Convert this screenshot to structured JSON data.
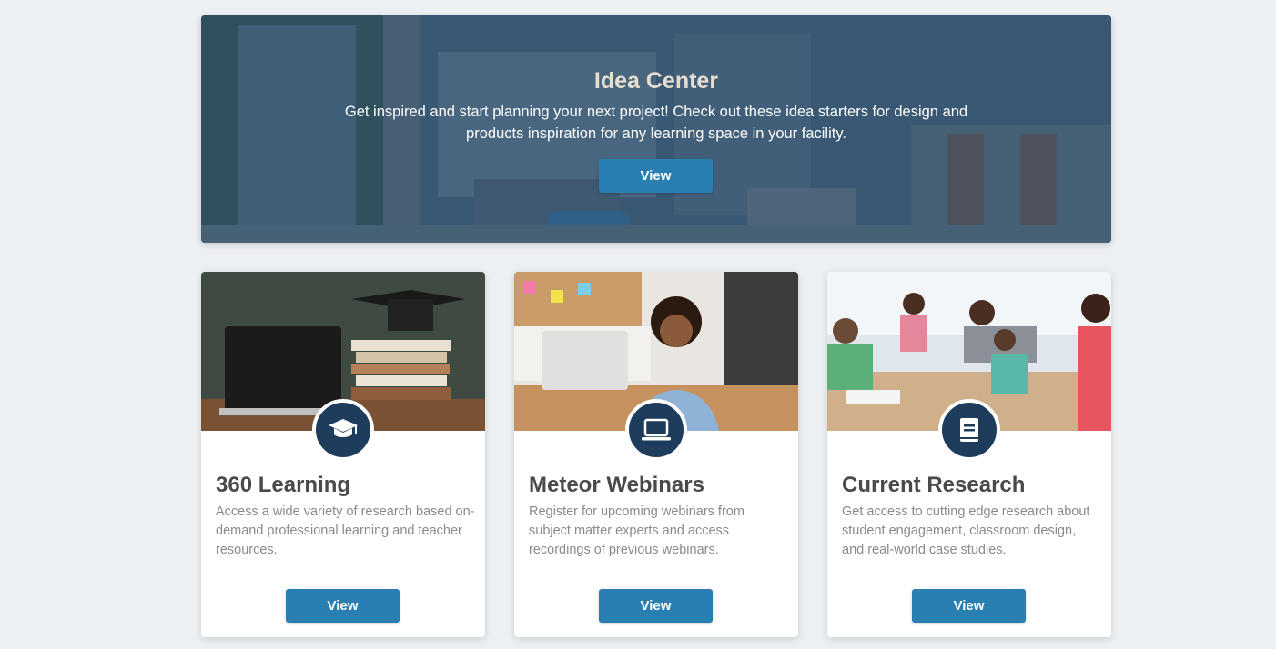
{
  "hero": {
    "title": "Idea Center",
    "description": "Get inspired and start planning your next project! Check out these idea starters for design and products inspiration for any learning space in your facility.",
    "button_label": "View"
  },
  "cards": [
    {
      "title": "360 Learning",
      "description": "Access a wide variety of research based on-demand professional learning and teacher resources.",
      "button_label": "View",
      "icon": "graduation-cap-icon"
    },
    {
      "title": "Meteor Webinars",
      "description": "Register for upcoming webinars from subject matter experts and access recordings of previous webinars.",
      "button_label": "View",
      "icon": "laptop-icon"
    },
    {
      "title": "Current Research",
      "description": "Get access to cutting edge research about student engagement, classroom design, and real-world case studies.",
      "button_label": "View",
      "icon": "book-icon"
    }
  ],
  "colors": {
    "accent": "#2a7fb2",
    "icon_circle": "#1e3d5c",
    "hero_title": "#e6ddd0",
    "card_title": "#4a4a4a",
    "card_text": "#8a8a8a",
    "page_bg": "#edf0f3"
  }
}
